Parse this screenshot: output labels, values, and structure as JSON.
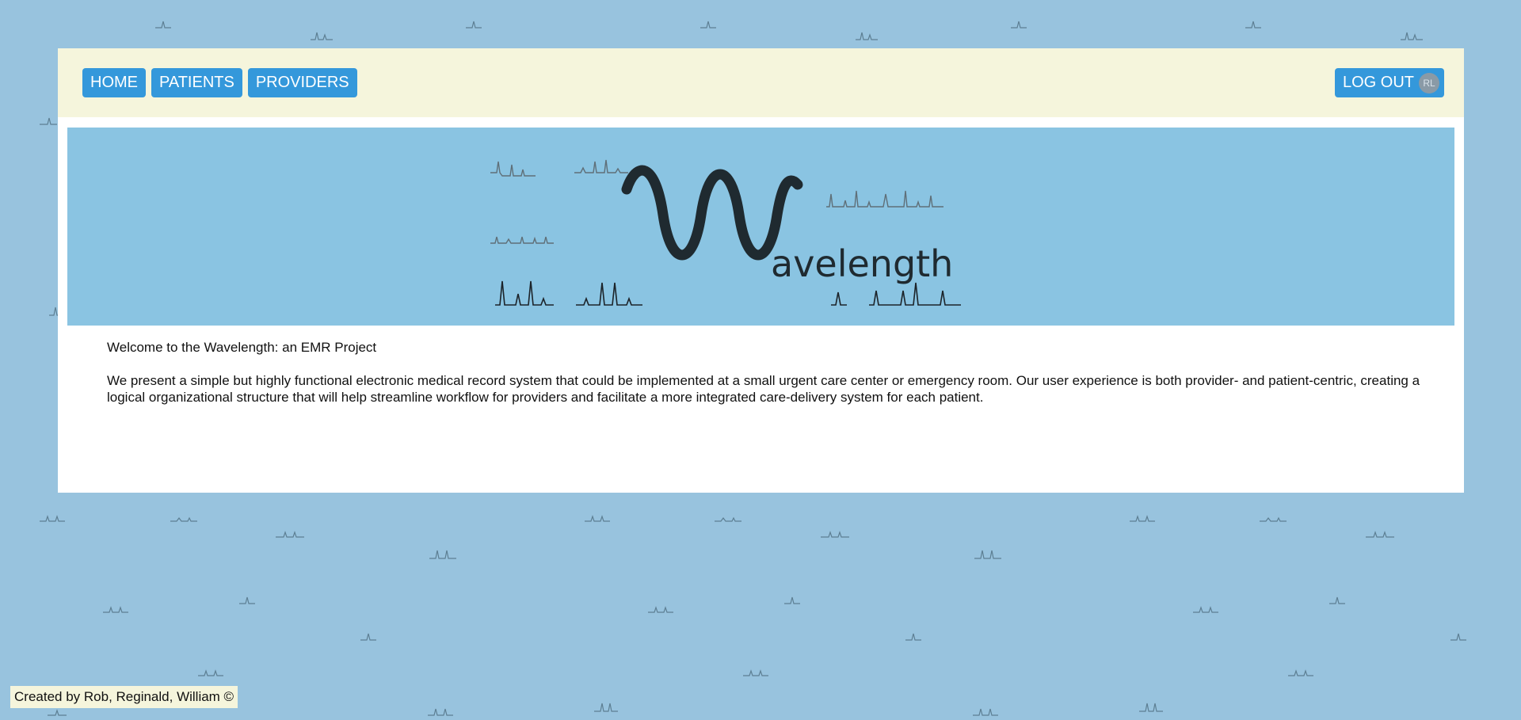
{
  "nav": {
    "items": [
      {
        "label": "HOME"
      },
      {
        "label": "PATIENTS"
      },
      {
        "label": "PROVIDERS"
      }
    ],
    "logout_label": "LOG OUT",
    "avatar_initials": "RL"
  },
  "banner": {
    "logo_letter": "W",
    "logo_text": "avelength"
  },
  "content": {
    "welcome": "Welcome to the Wavelength: an EMR Project",
    "description": "We present a simple but highly functional electronic medical record system that could be implemented at a small urgent care center or emergency room. Our user experience is both provider- and patient-centric, creating a logical organizational structure that will help streamline workflow for providers and facilitate a more integrated care-delivery system for each patient."
  },
  "footer": {
    "credit": "Created by Rob, Reginald, William ©"
  },
  "colors": {
    "page_background": "#98c3de",
    "navbar_background": "#f5f5dc",
    "button_blue": "#3498db",
    "banner_blue": "#8ac4e2",
    "logo_dark": "#1f2a30"
  }
}
